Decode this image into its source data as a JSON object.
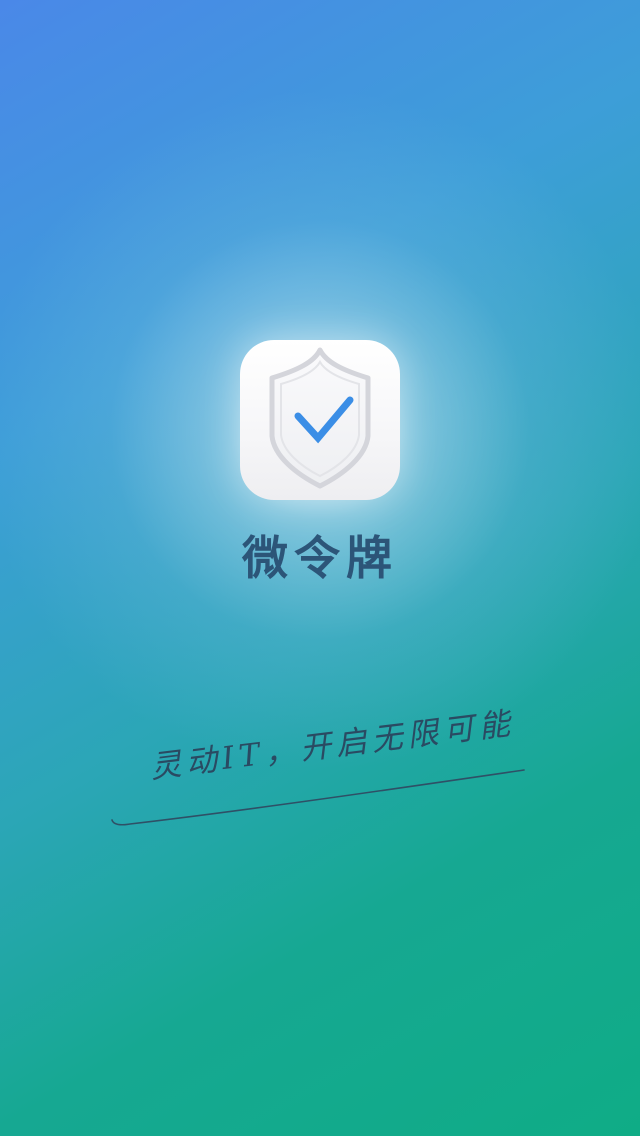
{
  "app": {
    "name": "微令牌",
    "icon": "shield-check-icon"
  },
  "slogan": {
    "text": "灵动IT，开启无限可能"
  },
  "colors": {
    "background_top": "#4a88e8",
    "background_bottom": "#0fac86",
    "title": "#2c5578",
    "check": "#3b8ee6",
    "shield_outline": "#d6d6dc"
  }
}
